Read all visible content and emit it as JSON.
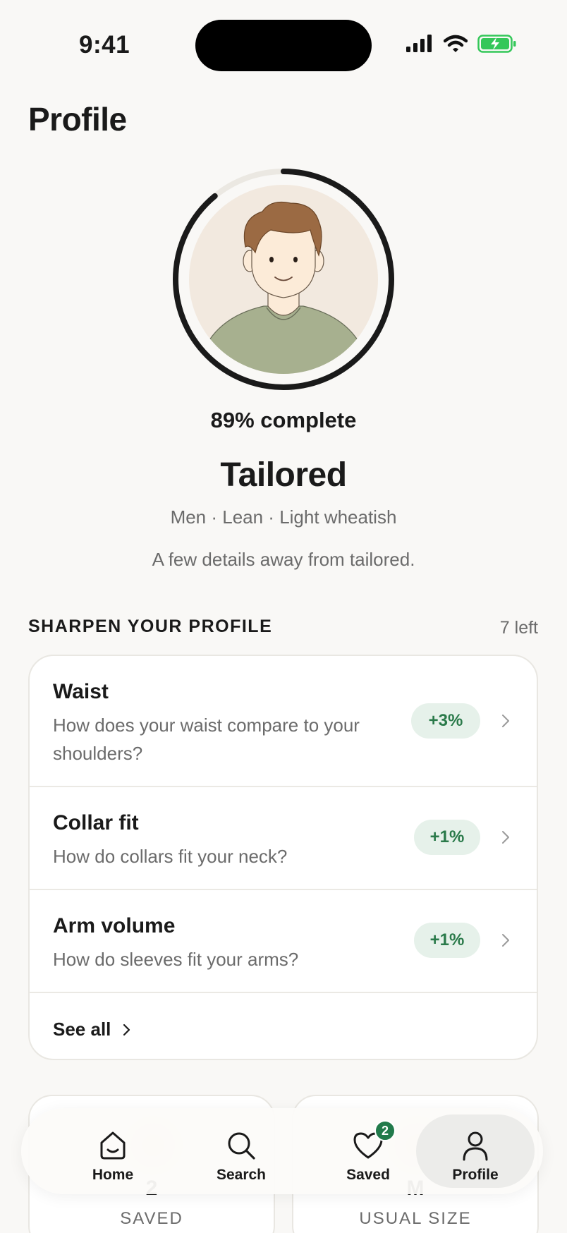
{
  "status_bar": {
    "time": "9:41"
  },
  "page": {
    "title": "Profile"
  },
  "profile": {
    "completion_fraction": 0.89,
    "completion_text": "89% complete",
    "tier": "Tailored",
    "attributes": "Men · Lean · Light wheatish",
    "tagline": "A few details away from tailored."
  },
  "sharpen": {
    "heading": "SHARPEN YOUR PROFILE",
    "count": "7 left",
    "items": [
      {
        "title": "Waist",
        "description": "How does your waist compare to your shoulders?",
        "gain": "+3%"
      },
      {
        "title": "Collar fit",
        "description": "How do collars fit your neck?",
        "gain": "+1%"
      },
      {
        "title": "Arm volume",
        "description": "How do sleeves fit your arms?",
        "gain": "+1%"
      }
    ],
    "see_all": "See all"
  },
  "stats": [
    {
      "value": "2",
      "label": "SAVED"
    },
    {
      "value": "M",
      "label": "USUAL SIZE"
    }
  ],
  "tabbar": {
    "tabs": [
      {
        "label": "Home",
        "icon": "home-icon"
      },
      {
        "label": "Search",
        "icon": "search-icon"
      },
      {
        "label": "Saved",
        "icon": "heart-icon",
        "badge": "2"
      },
      {
        "label": "Profile",
        "icon": "person-icon",
        "active": true
      }
    ]
  },
  "colors": {
    "background": "#f9f8f6",
    "accent_green": "#217a4b",
    "badge_bg": "#e6f1ea",
    "ring": "#1a1a1a",
    "battery": "#34c759"
  }
}
